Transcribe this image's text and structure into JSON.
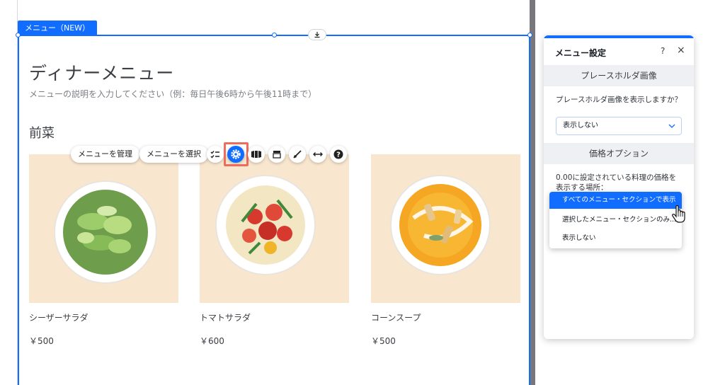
{
  "section_tag": "メニュー（NEW）",
  "menu": {
    "title": "ディナーメニュー",
    "description": "メニューの説明を入力してください（例：毎日午後6時から午後11時まで）",
    "section_title": "前菜",
    "dishes": [
      {
        "name": "シーザーサラダ",
        "price": "￥500"
      },
      {
        "name": "トマトサラダ",
        "price": "￥600"
      },
      {
        "name": "コーンスープ",
        "price": "￥500"
      }
    ]
  },
  "toolbar": {
    "manage_label": "メニューを管理",
    "select_label": "メニューを選択",
    "icons": [
      "checklist-icon",
      "settings-icon",
      "layout-icon",
      "design-icon",
      "brush-icon",
      "stretch-icon",
      "help-icon"
    ]
  },
  "panel": {
    "title": "メニュー設定",
    "help": "?",
    "close": "×",
    "placeholder_heading": "プレースホルダ画像",
    "placeholder_question": "プレースホルダ画像を表示しますか？",
    "placeholder_select": "表示しない",
    "price_heading": "価格オプション",
    "price_question": "0.00に設定されている料理の価格を表示する場所：",
    "price_options": [
      "すべてのメニュー・セクションで表示",
      "選択したメニュー・セクションのみ...",
      "表示しない"
    ]
  },
  "colors": {
    "accent": "#116dff",
    "food_bg": "#f8e6cf",
    "highlight": "#ef6b5b"
  }
}
